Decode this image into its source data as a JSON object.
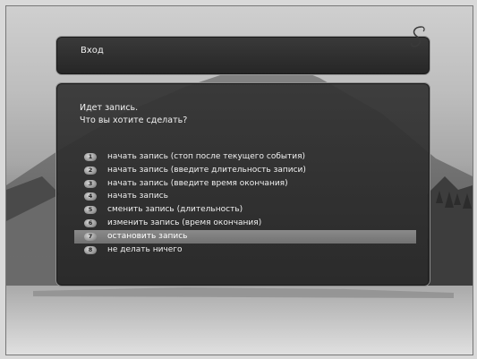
{
  "header": {
    "title": "Вход",
    "logo_icon": "swirl-logo-icon"
  },
  "dialog": {
    "message_line1": "Идет запись.",
    "message_line2": "Что вы хотите сделать?",
    "selected_index": 7,
    "options": [
      {
        "number": "1",
        "label": "начать запись (стоп после текущего события)"
      },
      {
        "number": "2",
        "label": "начать запись (введите длительность записи)"
      },
      {
        "number": "3",
        "label": "начать запись (введите время окончания)"
      },
      {
        "number": "4",
        "label": "начать запись"
      },
      {
        "number": "5",
        "label": "сменить запись (длительность)"
      },
      {
        "number": "6",
        "label": "изменить запись (время окончания)"
      },
      {
        "number": "7",
        "label": "остановить запись"
      },
      {
        "number": "8",
        "label": "не делать ничего"
      }
    ]
  },
  "colors": {
    "panel_background": "#2e2e2e",
    "panel_border": "#9a9a9a",
    "selection_highlight": "#7f7f7f",
    "text": "#f2f2f2"
  }
}
